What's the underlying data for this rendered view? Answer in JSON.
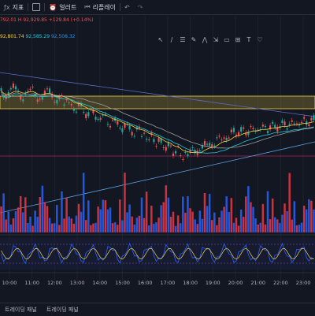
{
  "toolbar": {
    "indicators_label": "지표",
    "alert_label": "얼러트",
    "replay_label": "리플레이"
  },
  "legend": {
    "line1": "792.01  H 92,929.85  +129.84 (+0.14%)",
    "line2_a": "92,801.74",
    "line2_b": "92,585.29",
    "line2_c": "92,508.32"
  },
  "drawing_tools": [
    "cursor-icon",
    "trendline-icon",
    "fib-icon",
    "brush-icon",
    "pattern-icon",
    "forecast-icon",
    "shapes-icon",
    "measure-icon",
    "text-icon",
    "icon-icon"
  ],
  "time_labels": [
    "10:00",
    "11:00",
    "12:00",
    "13:00",
    "14:00",
    "15:00",
    "16:00",
    "17:00",
    "18:00",
    "19:00",
    "20:00",
    "21:00",
    "22:00",
    "23:00"
  ],
  "bottom": {
    "tab1": "트레이딩 패널",
    "tab2": "트레이딩 패널"
  },
  "colors": {
    "up": "#26a69a",
    "down": "#ef5350",
    "volume_up": "#2962ff",
    "volume_down": "#f23645",
    "zone": "#f5d142"
  }
}
